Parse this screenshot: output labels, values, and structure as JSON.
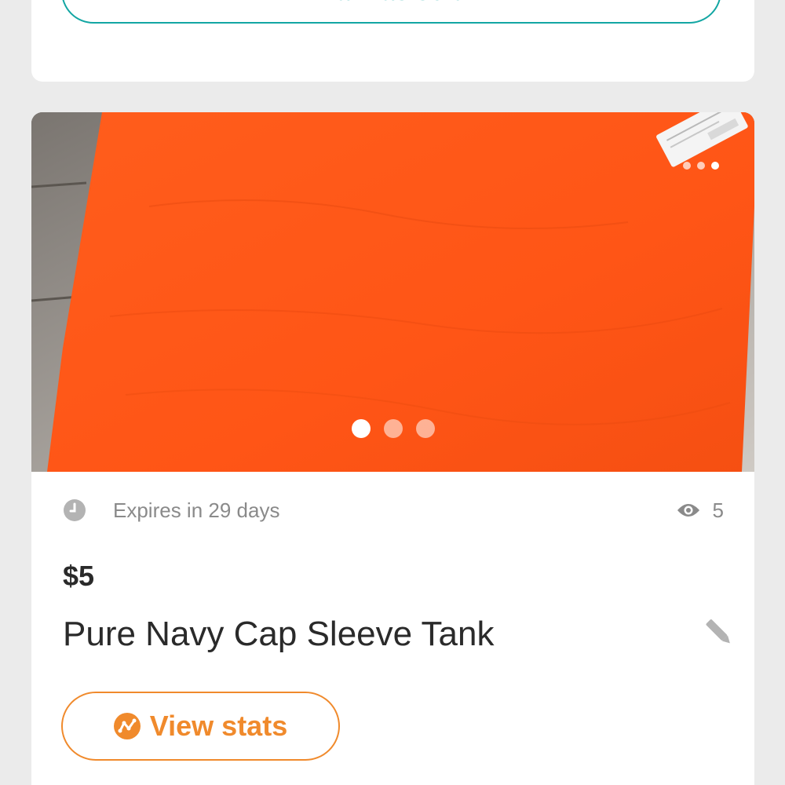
{
  "top_card": {
    "mark_sold_label": "Mark as sold"
  },
  "listing": {
    "photo_count": 3,
    "active_photo_index": 0,
    "expires_text": "Expires in 29 days",
    "views_count": "5",
    "price": "$5",
    "title": "Pure Navy Cap Sleeve Tank",
    "view_stats_label": "View stats"
  },
  "colors": {
    "teal_accent": "#13a6a3",
    "orange_accent": "#f08a2c",
    "photo_garment": "#ff5a1a",
    "muted_text": "#8a8a8a",
    "primary_text": "#2a2a2a"
  },
  "icons": {
    "expires": "clock-icon",
    "views": "eye-icon",
    "edit": "pencil-icon",
    "stats": "stats-chart-icon"
  }
}
